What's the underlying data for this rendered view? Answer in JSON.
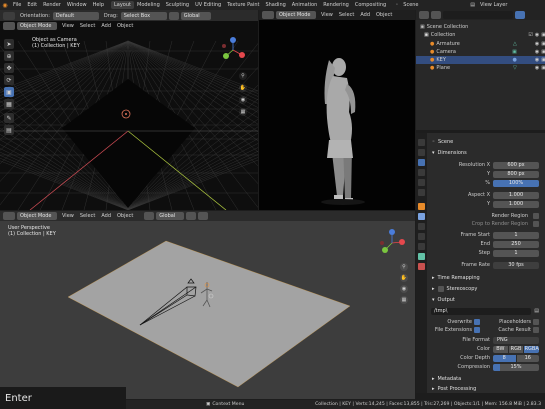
{
  "top_bar": {
    "menu": [
      "File",
      "Edit",
      "Render",
      "Window",
      "Help"
    ],
    "workspaces": [
      "Layout",
      "Modeling",
      "Sculpting",
      "UV Editing",
      "Texture Paint",
      "Shading",
      "Animation",
      "Rendering",
      "Compositing"
    ],
    "active_workspace": "Layout",
    "scene_label": "Scene",
    "view_layer_label": "View Layer"
  },
  "tool_header": {
    "orientation_label": "Orientation:",
    "orientation_value": "Default",
    "drag_label": "Drag:",
    "drag_value": "Select Box",
    "pivot_value": "Global"
  },
  "viewport_top_left": {
    "mode": "Object Mode",
    "menus": [
      "View",
      "Select",
      "Add",
      "Object"
    ],
    "overlay_title": "Object as Camera",
    "overlay_sub": "(1) Collection | KEY"
  },
  "viewport_top_right": {
    "mode": "Object Mode",
    "menus": [
      "View",
      "Select",
      "Add",
      "Object"
    ]
  },
  "viewport_bottom": {
    "mode": "Object Mode",
    "menus": [
      "View",
      "Select",
      "Add",
      "Object"
    ],
    "pivot": "Global",
    "overlay_title": "User Perspective",
    "overlay_sub": "(1) Collection | KEY"
  },
  "outliner": {
    "root": "Scene Collection",
    "collection": "Collection",
    "items": [
      "Armature",
      "Camera",
      "KEY",
      "Plane"
    ],
    "selected_item": "KEY"
  },
  "properties": {
    "breadcrumb": "Scene",
    "dimensions_header": "Dimensions",
    "fields": [
      {
        "label": "Resolution X",
        "value": "600 px"
      },
      {
        "label": "Y",
        "value": "800 px"
      },
      {
        "label": "%",
        "value": "100%",
        "percent": 100
      }
    ],
    "aspect": [
      {
        "label": "Aspect X",
        "value": "1.000"
      },
      {
        "label": "Y",
        "value": "1.000"
      }
    ],
    "render_region_label": "Render Region",
    "crop_label": "Crop to Render Region",
    "frames": [
      {
        "label": "Frame Start",
        "value": "1"
      },
      {
        "label": "End",
        "value": "250"
      },
      {
        "label": "Step",
        "value": "1"
      }
    ],
    "frame_rate_label": "Frame Rate",
    "frame_rate_value": "30 fps",
    "time_remapping": "Time Remapping",
    "stereoscopy": "Stereoscopy",
    "output_header": "Output",
    "output_path": "/tmp\\",
    "overwrite_label": "Overwrite",
    "placeholders_label": "Placeholders",
    "file_ext_label": "File Extensions",
    "cache_label": "Cache Result",
    "file_format_label": "File Format",
    "file_format_value": "PNG",
    "color_label": "Color",
    "color_options": [
      "BW",
      "RGB",
      "RGBA"
    ],
    "color_selected": "RGBA",
    "color_depth_label": "Color Depth",
    "color_depth_options": [
      "8",
      "16"
    ],
    "color_depth_selected": "8",
    "compression_label": "Compression",
    "compression_value": "15%",
    "compression_percent": 15,
    "metadata_header": "Metadata",
    "post_processing_header": "Post Processing"
  },
  "status_bar": {
    "context_menu": "Context Menu",
    "stats": "Collection | KEY | Verts:14,245 | Faces:13,855 | Tris:27,269 | Objects:1/1 | Mem: 156.8 MiB | 2.83.3"
  },
  "key_overlay": "Enter",
  "colors": {
    "accent": "#4772b3",
    "active_tab": "#3d3d3d",
    "x_axis": "#e5484d",
    "y_axis": "#7bc63f",
    "z_axis": "#4a7ddb"
  }
}
